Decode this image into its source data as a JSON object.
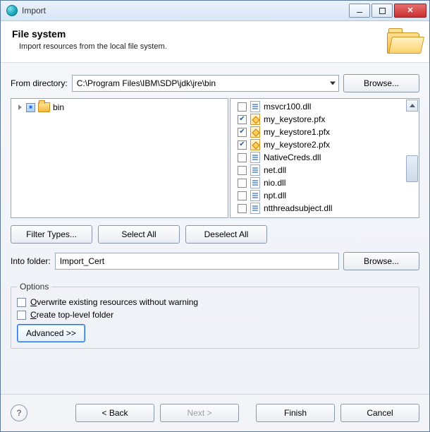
{
  "window": {
    "title": "Import"
  },
  "titlebar_buttons": {
    "minimize": "–",
    "maximize": "▢",
    "close": "✕"
  },
  "header": {
    "title": "File system",
    "subtitle": "Import resources from the local file system."
  },
  "from_directory": {
    "label": "From directory:",
    "value": "C:\\Program Files\\IBM\\SDP\\jdk\\jre\\bin",
    "browse": "Browse..."
  },
  "tree": {
    "root": {
      "label": "bin",
      "state": "mixed"
    }
  },
  "files": [
    {
      "name": "msvcr100.dll",
      "checked": false,
      "type": "dll"
    },
    {
      "name": "my_keystore.pfx",
      "checked": true,
      "type": "pfx"
    },
    {
      "name": "my_keystore1.pfx",
      "checked": true,
      "type": "pfx"
    },
    {
      "name": "my_keystore2.pfx",
      "checked": true,
      "type": "pfx"
    },
    {
      "name": "NativeCreds.dll",
      "checked": false,
      "type": "dll"
    },
    {
      "name": "net.dll",
      "checked": false,
      "type": "dll"
    },
    {
      "name": "nio.dll",
      "checked": false,
      "type": "dll"
    },
    {
      "name": "npt.dll",
      "checked": false,
      "type": "dll"
    },
    {
      "name": "ntthreadsubject.dll",
      "checked": false,
      "type": "dll"
    }
  ],
  "buttons": {
    "filter_types": "Filter Types...",
    "select_all": "Select All",
    "deselect_all": "Deselect All"
  },
  "into_folder": {
    "label": "Into folder:",
    "value": "Import_Cert",
    "browse": "Browse..."
  },
  "options": {
    "legend": "Options",
    "overwrite": {
      "label_pre": "",
      "u": "O",
      "label_post": "verwrite existing resources without warning",
      "checked": false
    },
    "toplevel": {
      "label_pre": "",
      "u": "C",
      "label_post": "reate top-level folder",
      "checked": false
    },
    "advanced": "Advanced >>"
  },
  "footer": {
    "back": "< Back",
    "next": "Next >",
    "finish": "Finish",
    "cancel": "Cancel"
  }
}
